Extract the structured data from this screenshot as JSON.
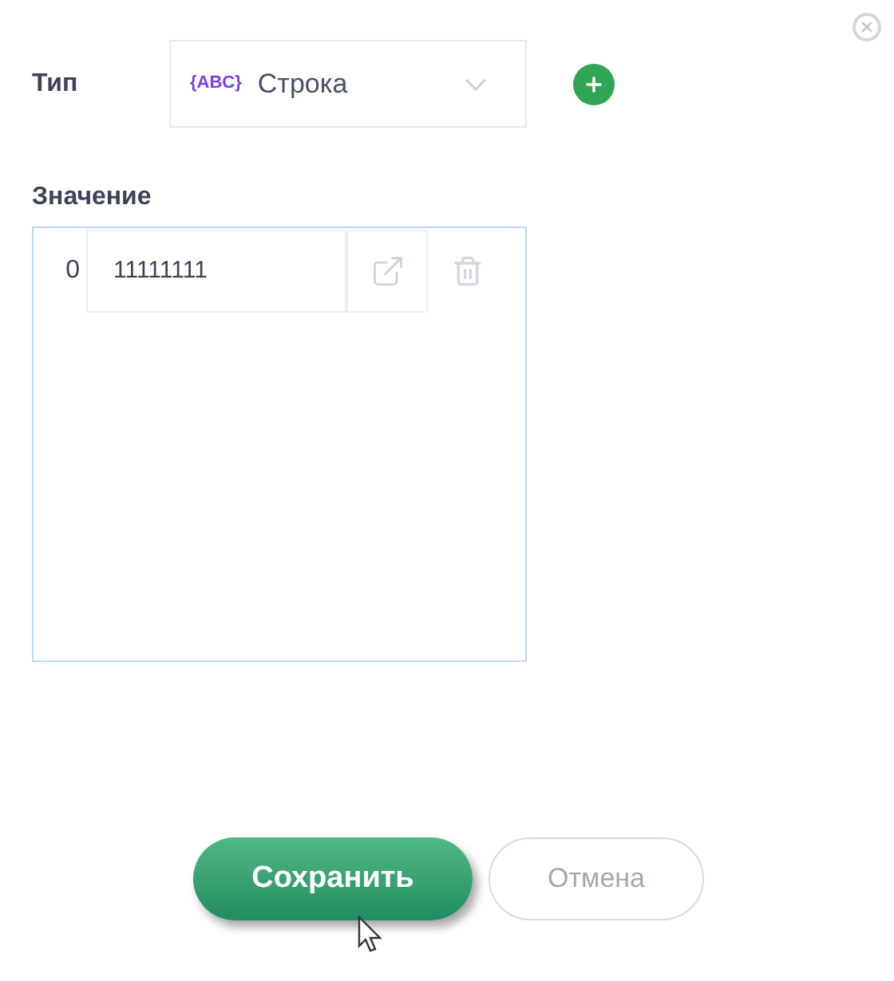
{
  "type_field": {
    "label": "Тип",
    "icon_text": "{ABC}",
    "value": "Строка"
  },
  "value_field": {
    "label": "Значение",
    "items": [
      {
        "index": "0",
        "value": "11111111"
      }
    ]
  },
  "buttons": {
    "save": "Сохранить",
    "cancel": "Отмена"
  }
}
